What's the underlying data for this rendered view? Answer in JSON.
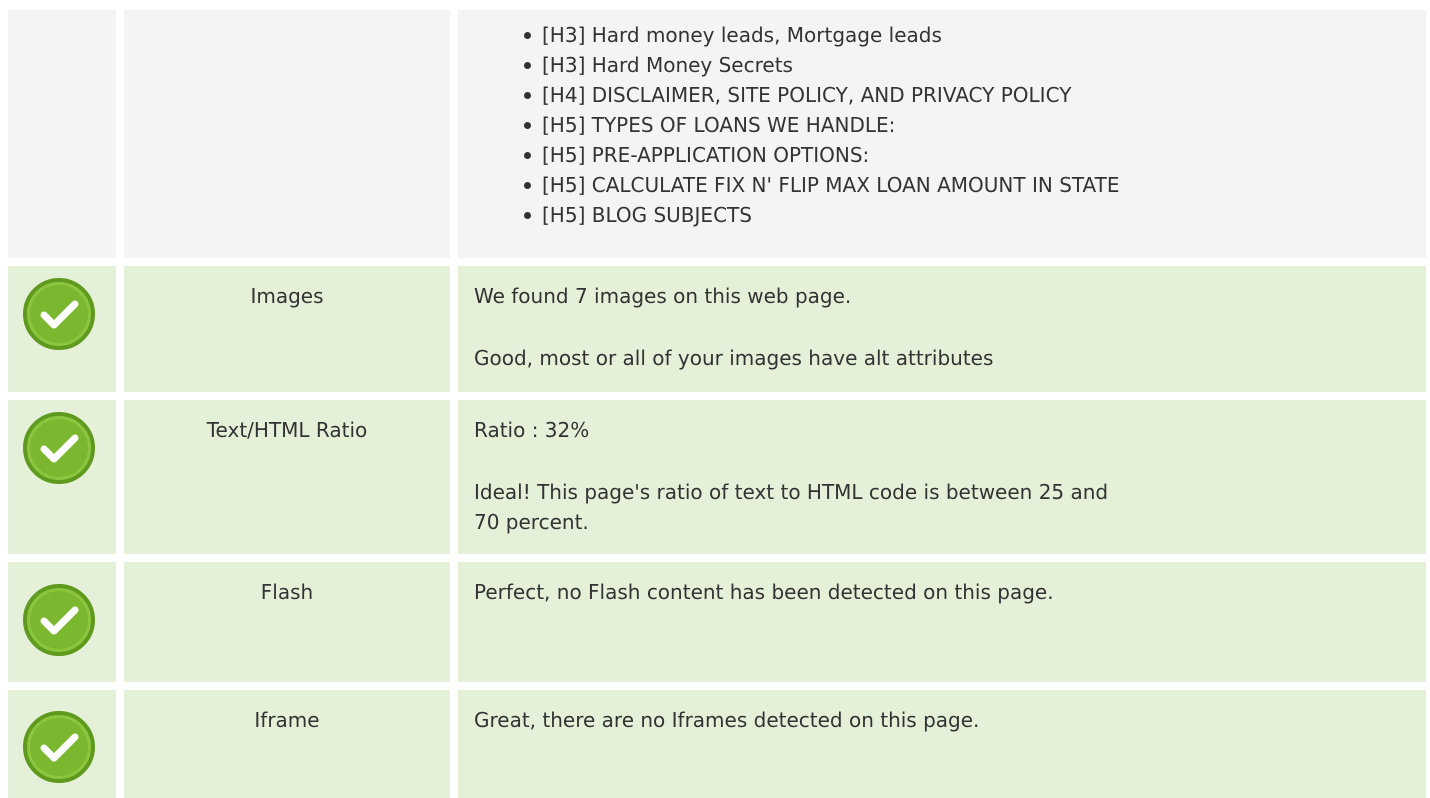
{
  "headings": {
    "items": [
      "[H3] Hard money leads, Mortgage leads",
      "[H3] Hard Money Secrets",
      "[H4] DISCLAIMER, SITE POLICY, AND PRIVACY POLICY",
      "[H5] TYPES OF LOANS WE HANDLE:",
      "[H5] PRE-APPLICATION OPTIONS:",
      "[H5] CALCULATE FIX N' FLIP MAX LOAN AMOUNT IN STATE",
      "[H5] BLOG SUBJECTS"
    ]
  },
  "rows": {
    "images": {
      "label": "Images",
      "line1": "We found 7 images on this web page.",
      "line2": "Good, most or all of your images have alt attributes"
    },
    "ratio": {
      "label": "Text/HTML Ratio",
      "line1": "Ratio : 32%",
      "line2": "Ideal! This page's ratio of text to HTML code is between 25 and 70 percent."
    },
    "flash": {
      "label": "Flash",
      "line1": "Perfect, no Flash content has been detected on this page."
    },
    "iframe": {
      "label": "Iframe",
      "line1": "Great, there are no Iframes detected on this page."
    }
  },
  "status_icon": "check-circle-icon",
  "colors": {
    "pass_row_bg": "#e4f1d8",
    "neutral_row_bg": "#f4f4f4",
    "check_green": "#7cb82f"
  }
}
